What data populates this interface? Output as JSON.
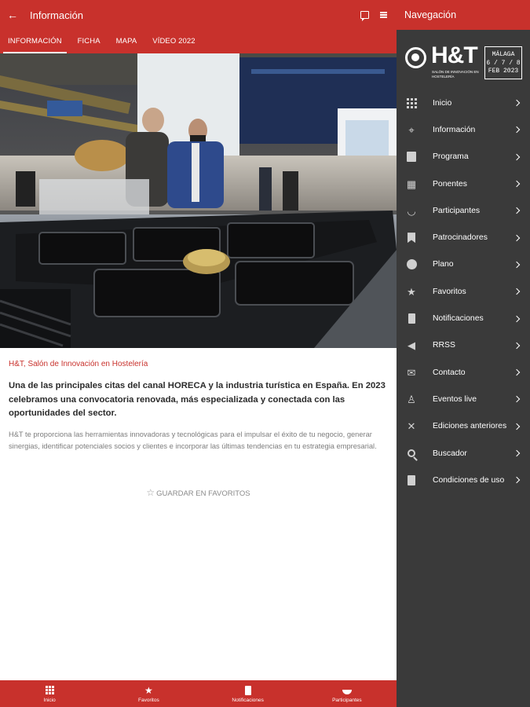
{
  "appbar": {
    "title": "Información",
    "back_icon": "arrow-left-icon"
  },
  "tabs": [
    {
      "label": "INFORMACIÓN",
      "active": true
    },
    {
      "label": "FICHA",
      "active": false
    },
    {
      "label": "MAPA",
      "active": false
    },
    {
      "label": "VÍDEO 2022",
      "active": false
    }
  ],
  "content": {
    "subtitle": "H&T, Salón de Innovación en Hostelería",
    "lead": "Una de las principales citas del canal HORECA y la industria turística en España. En 2023 celebramos una convocatoria renovada, más especializada y conectada con las oportunidades del sector.",
    "body": "H&T te proporciona las herramientas innovadoras y tecnológicas para el impulsar el éxito de tu negocio, generar sinergias, identificar potenciales socios y clientes e incorporar las últimas tendencias en tu estrategia empresarial.",
    "favorite_label": "GUARDAR EN FAVORITOS"
  },
  "bottombar": [
    {
      "label": "Inicio",
      "icon": "grid-icon"
    },
    {
      "label": "Favoritos",
      "icon": "star-icon"
    },
    {
      "label": "Notificaciones",
      "icon": "phone-icon"
    },
    {
      "label": "Participantes",
      "icon": "bowl-icon"
    }
  ],
  "nav": {
    "title": "Navegación",
    "brand": {
      "word": "H&T",
      "tagline": "SALÓN DE INNOVACIÓN EN HOSTELERÍA",
      "city": "MÁLAGA",
      "days": "6 / 7 / 8",
      "month_year": "FEB 2023"
    },
    "items": [
      {
        "label": "Inicio",
        "icon": "grid-icon"
      },
      {
        "label": "Información",
        "icon": "map-pin-icon"
      },
      {
        "label": "Programa",
        "icon": "calendar-icon"
      },
      {
        "label": "Ponentes",
        "icon": "speaker-icon"
      },
      {
        "label": "Participantes",
        "icon": "bowl-icon"
      },
      {
        "label": "Patrocinadores",
        "icon": "bookmark-icon"
      },
      {
        "label": "Plano",
        "icon": "compass-icon"
      },
      {
        "label": "Favoritos",
        "icon": "star-icon"
      },
      {
        "label": "Notificaciones",
        "icon": "phone-icon"
      },
      {
        "label": "RRSS",
        "icon": "megaphone-icon"
      },
      {
        "label": "Contacto",
        "icon": "mail-icon"
      },
      {
        "label": "Eventos live",
        "icon": "podium-icon"
      },
      {
        "label": "Ediciones anteriores",
        "icon": "utensils-icon"
      },
      {
        "label": "Buscador",
        "icon": "search-icon"
      },
      {
        "label": "Condiciones de uso",
        "icon": "document-icon"
      }
    ]
  },
  "colors": {
    "brand_red": "#c8312c",
    "drawer_bg": "#3a3a3a"
  }
}
